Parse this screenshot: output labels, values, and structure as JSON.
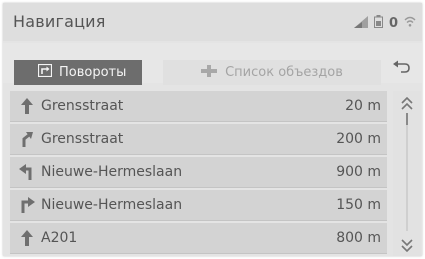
{
  "header": {
    "title": "Навигация",
    "status_value": "0",
    "icons": [
      "signal-icon",
      "battery-icon",
      "wifi-icon"
    ]
  },
  "tabs": [
    {
      "label": "Повороты",
      "icon": "turns-icon",
      "active": true
    },
    {
      "label": "Список объездов",
      "icon": "detour-list-icon",
      "active": false
    }
  ],
  "back_icon": "back-arrow-icon",
  "directions": [
    {
      "street": "Grensstraat",
      "distance": "20 m",
      "icon": "straight-arrow-icon"
    },
    {
      "street": "Grensstraat",
      "distance": "200 m",
      "icon": "slight-right-arrow-icon"
    },
    {
      "street": "Nieuwe-Hermeslaan",
      "distance": "900 m",
      "icon": "left-turn-arrow-icon"
    },
    {
      "street": "Nieuwe-Hermeslaan",
      "distance": "150 m",
      "icon": "right-turn-arrow-icon"
    },
    {
      "street": "A201",
      "distance": "800 m",
      "icon": "straight-arrow-icon"
    }
  ],
  "scroll": {
    "up_icon": "double-chevron-up-icon",
    "down_icon": "double-chevron-down-icon",
    "position": 0.0
  },
  "colors": {
    "active_tab": "#6d6d6d",
    "row_bg": "#d3d3d3",
    "screen_bg": "#e4e4e4"
  }
}
